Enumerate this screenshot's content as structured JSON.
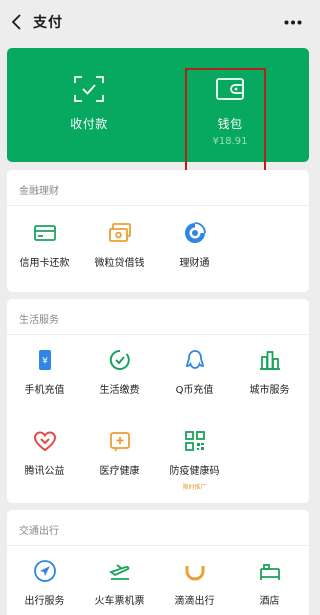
{
  "header": {
    "title": "支付",
    "back_icon": "chevron-left-icon",
    "more_icon": "more-dots-icon"
  },
  "hero": {
    "background": "#07a85f",
    "pay_label": "收付款",
    "pay_icon": "scan-pay-icon",
    "wallet_label": "钱包",
    "wallet_balance": "¥18.91",
    "wallet_icon": "wallet-icon",
    "highlight_color": "#b3221b"
  },
  "finance": {
    "title": "金融理财",
    "items": [
      {
        "label": "信用卡还款",
        "icon": "credit-card-icon",
        "color": "#19a35b"
      },
      {
        "label": "微粒贷借钱",
        "icon": "loan-icon",
        "color": "#e9a135"
      },
      {
        "label": "理财通",
        "icon": "wealth-icon",
        "color": "#2f86e6"
      }
    ]
  },
  "life": {
    "title": "生活服务",
    "items": [
      {
        "label": "手机充值",
        "icon": "phone-recharge-icon",
        "color": "#2f86e6"
      },
      {
        "label": "生活缴费",
        "icon": "utility-payment-icon",
        "color": "#19a35b"
      },
      {
        "label": "Q币充值",
        "icon": "qq-coin-icon",
        "color": "#2f86e6"
      },
      {
        "label": "城市服务",
        "icon": "city-service-icon",
        "color": "#19a35b"
      },
      {
        "label": "腾讯公益",
        "icon": "charity-icon",
        "color": "#e14b4b"
      },
      {
        "label": "医疗健康",
        "icon": "medical-icon",
        "color": "#e9a135"
      },
      {
        "label": "防疫健康码",
        "icon": "qr-code-icon",
        "color": "#19a35b",
        "note": "限时推广"
      }
    ]
  },
  "transport": {
    "title": "交通出行",
    "items": [
      {
        "label": "出行服务",
        "icon": "navigation-icon",
        "color": "#2f86e6"
      },
      {
        "label": "火车票机票",
        "icon": "train-ticket-icon",
        "color": "#19a35b"
      },
      {
        "label": "滴滴出行",
        "icon": "didi-icon",
        "color": "#e9a135"
      },
      {
        "label": "酒店",
        "icon": "hotel-icon",
        "color": "#19a35b"
      }
    ]
  }
}
